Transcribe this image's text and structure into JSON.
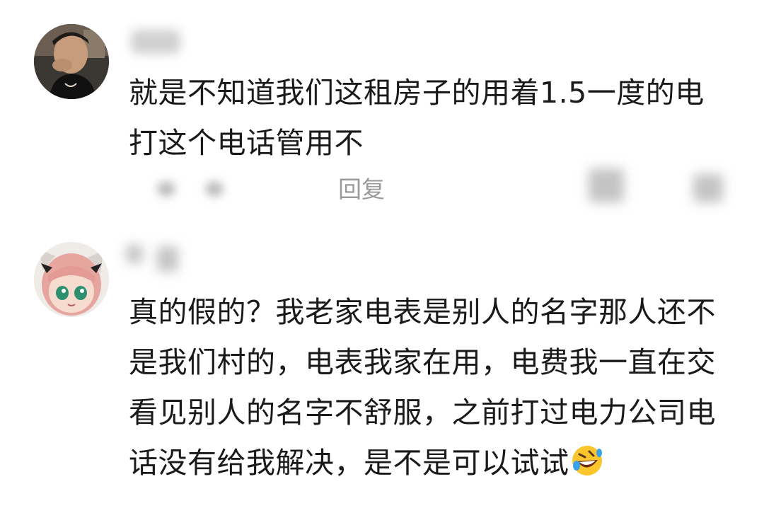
{
  "comments": [
    {
      "text": "就是不知道我们这租房子的用着1.5一度的电打这个电话管用不",
      "reply_label": "回复"
    },
    {
      "text": "真的假的？我老家电表是别人的名字那人还不是我们村的，电表我家在用，电费我一直在交看见别人的名字不舒服，之前打过电力公司电话没有给我解决，是不是可以试试",
      "emoji": "rolling-on-floor-laughing-emoji"
    }
  ],
  "icons": {
    "avatar_1": "user-photo-avatar",
    "avatar_2": "anime-girl-avatar"
  }
}
